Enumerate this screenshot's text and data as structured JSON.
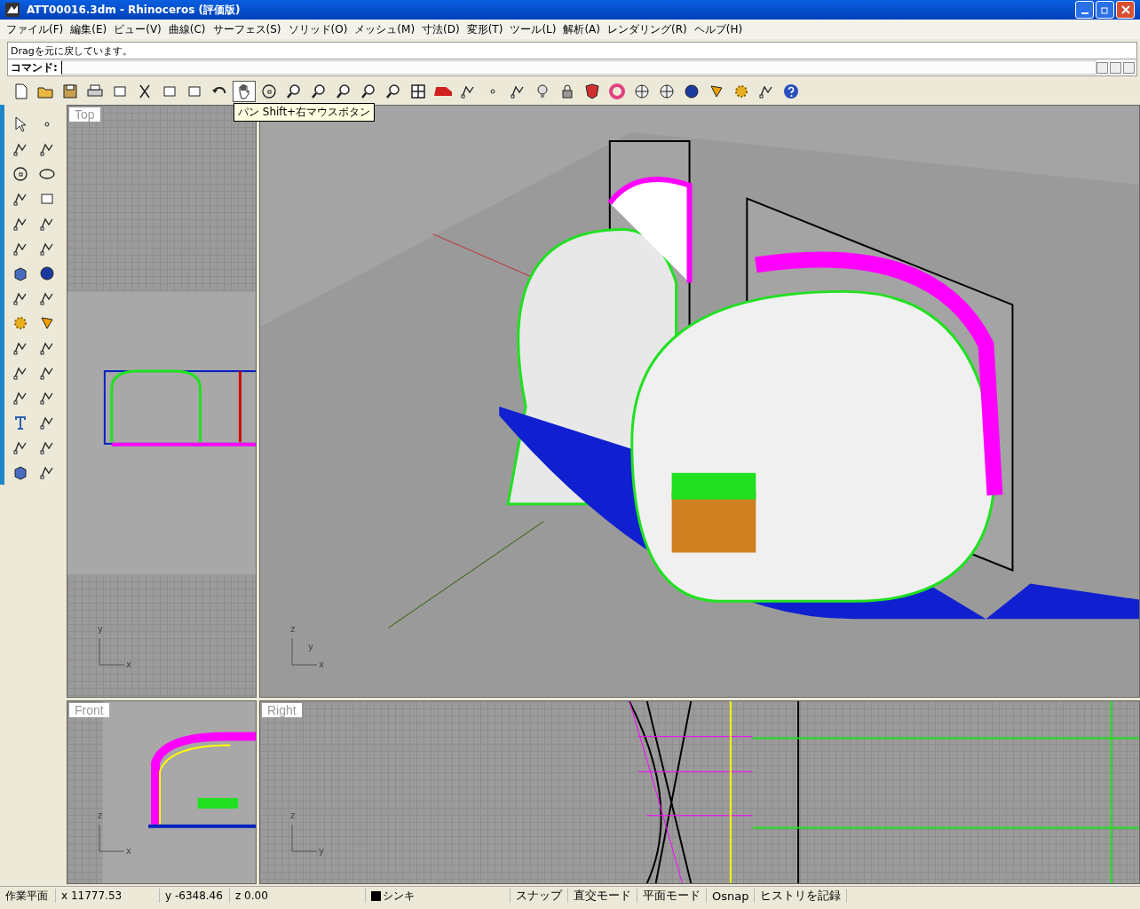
{
  "window": {
    "title": "ATT00016.3dm - Rhinoceros (評価版)"
  },
  "menu": [
    "ファイル(F)",
    "編集(E)",
    "ビュー(V)",
    "曲線(C)",
    "サーフェス(S)",
    "ソリッド(O)",
    "メッシュ(M)",
    "寸法(D)",
    "変形(T)",
    "ツール(L)",
    "解析(A)",
    "レンダリング(R)",
    "ヘルプ(H)"
  ],
  "command": {
    "history": "Dragを元に戻しています。",
    "prompt": "コマンド:"
  },
  "tooltip": "パン Shift+右マウスボタン",
  "viewports": [
    {
      "kind": "top",
      "label": "Top",
      "axes": [
        "y",
        "x"
      ]
    },
    {
      "kind": "perspective",
      "axes": [
        "z",
        "y",
        "x"
      ]
    },
    {
      "kind": "front",
      "label": "Front",
      "axes": [
        "z",
        "x"
      ]
    },
    {
      "kind": "right",
      "label": "Right",
      "axes": [
        "z",
        "y"
      ]
    }
  ],
  "status_bar": {
    "plane": "作業平面",
    "x": "x 11777.53",
    "y": "y -6348.46",
    "z": "z 0.00",
    "layer": {
      "name": "シンキ",
      "color": "#000000"
    },
    "panes": [
      "スナップ",
      "直交モード",
      "平面モード",
      "Osnap",
      "ヒストリを記録"
    ]
  }
}
